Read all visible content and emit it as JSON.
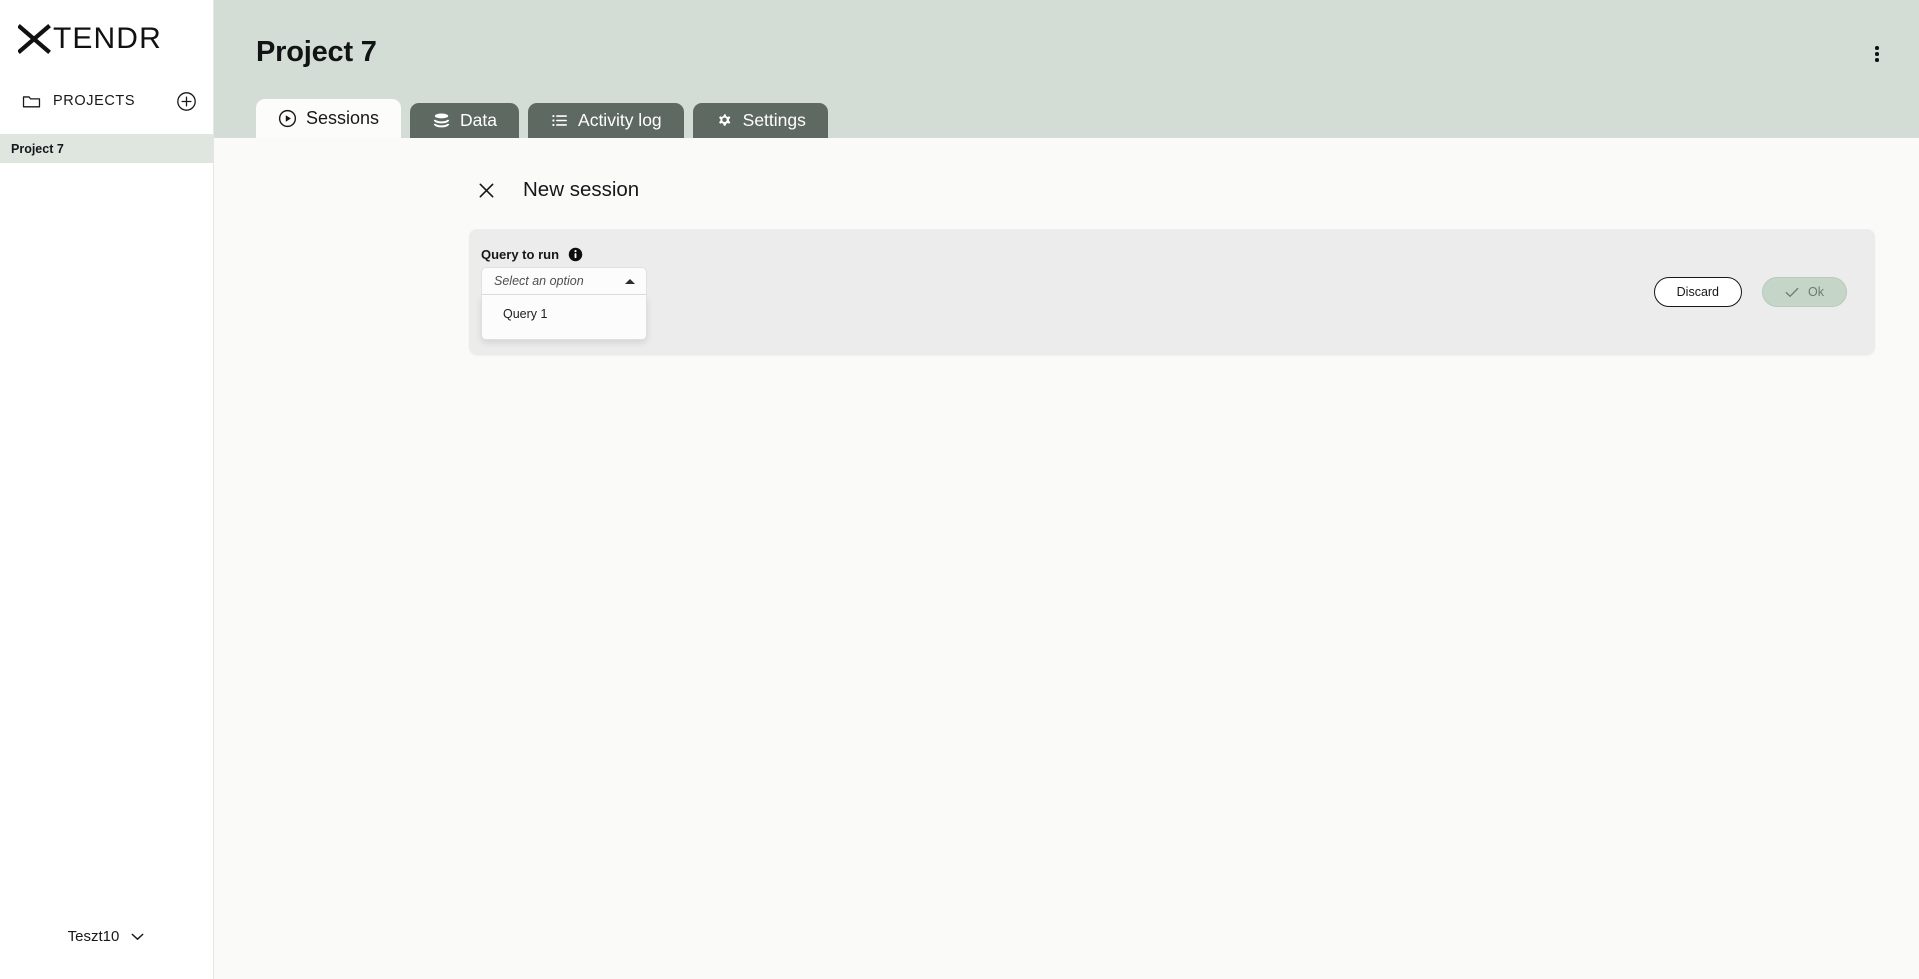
{
  "brand": {
    "logo_text": "TENDR",
    "logo_mark": "x-mark-icon"
  },
  "sidebar": {
    "projects_header": {
      "label": "PROJECTS",
      "folder_icon": "folder-icon",
      "add_icon": "plus-circle-icon"
    },
    "projects": [
      {
        "label": "Project 7",
        "selected": true
      }
    ],
    "user": {
      "name": "Teszt10",
      "chevron_icon": "chevron-down-icon"
    }
  },
  "header": {
    "title": "Project 7",
    "menu_icon": "kebab-menu-icon"
  },
  "tabs": [
    {
      "label": "Sessions",
      "icon": "play-circle-icon",
      "active": true
    },
    {
      "label": "Data",
      "icon": "database-icon",
      "active": false
    },
    {
      "label": "Activity log",
      "icon": "list-icon",
      "active": false
    },
    {
      "label": "Settings",
      "icon": "gear-icon",
      "active": false
    }
  ],
  "session_panel": {
    "close_icon": "close-icon",
    "title": "New session",
    "form": {
      "field_label": "Query to run",
      "info_icon": "info-icon",
      "select": {
        "placeholder": "Select an option",
        "value": "",
        "expanded": true,
        "caret_icon": "caret-up-icon",
        "options": [
          {
            "label": "Query 1"
          }
        ]
      },
      "actions": {
        "discard_label": "Discard",
        "ok_label": "Ok",
        "ok_icon": "check-icon",
        "ok_disabled": true
      }
    }
  },
  "colors": {
    "header_bg": "#d4dcd6",
    "tab_inactive_bg": "#5d6961",
    "tab_active_bg": "#fcfdfb",
    "content_bg": "#fafbf9",
    "card_bg": "#ececec",
    "sidebar_selected_bg": "#dfe6e0",
    "ok_button_bg": "#c5d6c9",
    "text_primary": "#15171a"
  }
}
